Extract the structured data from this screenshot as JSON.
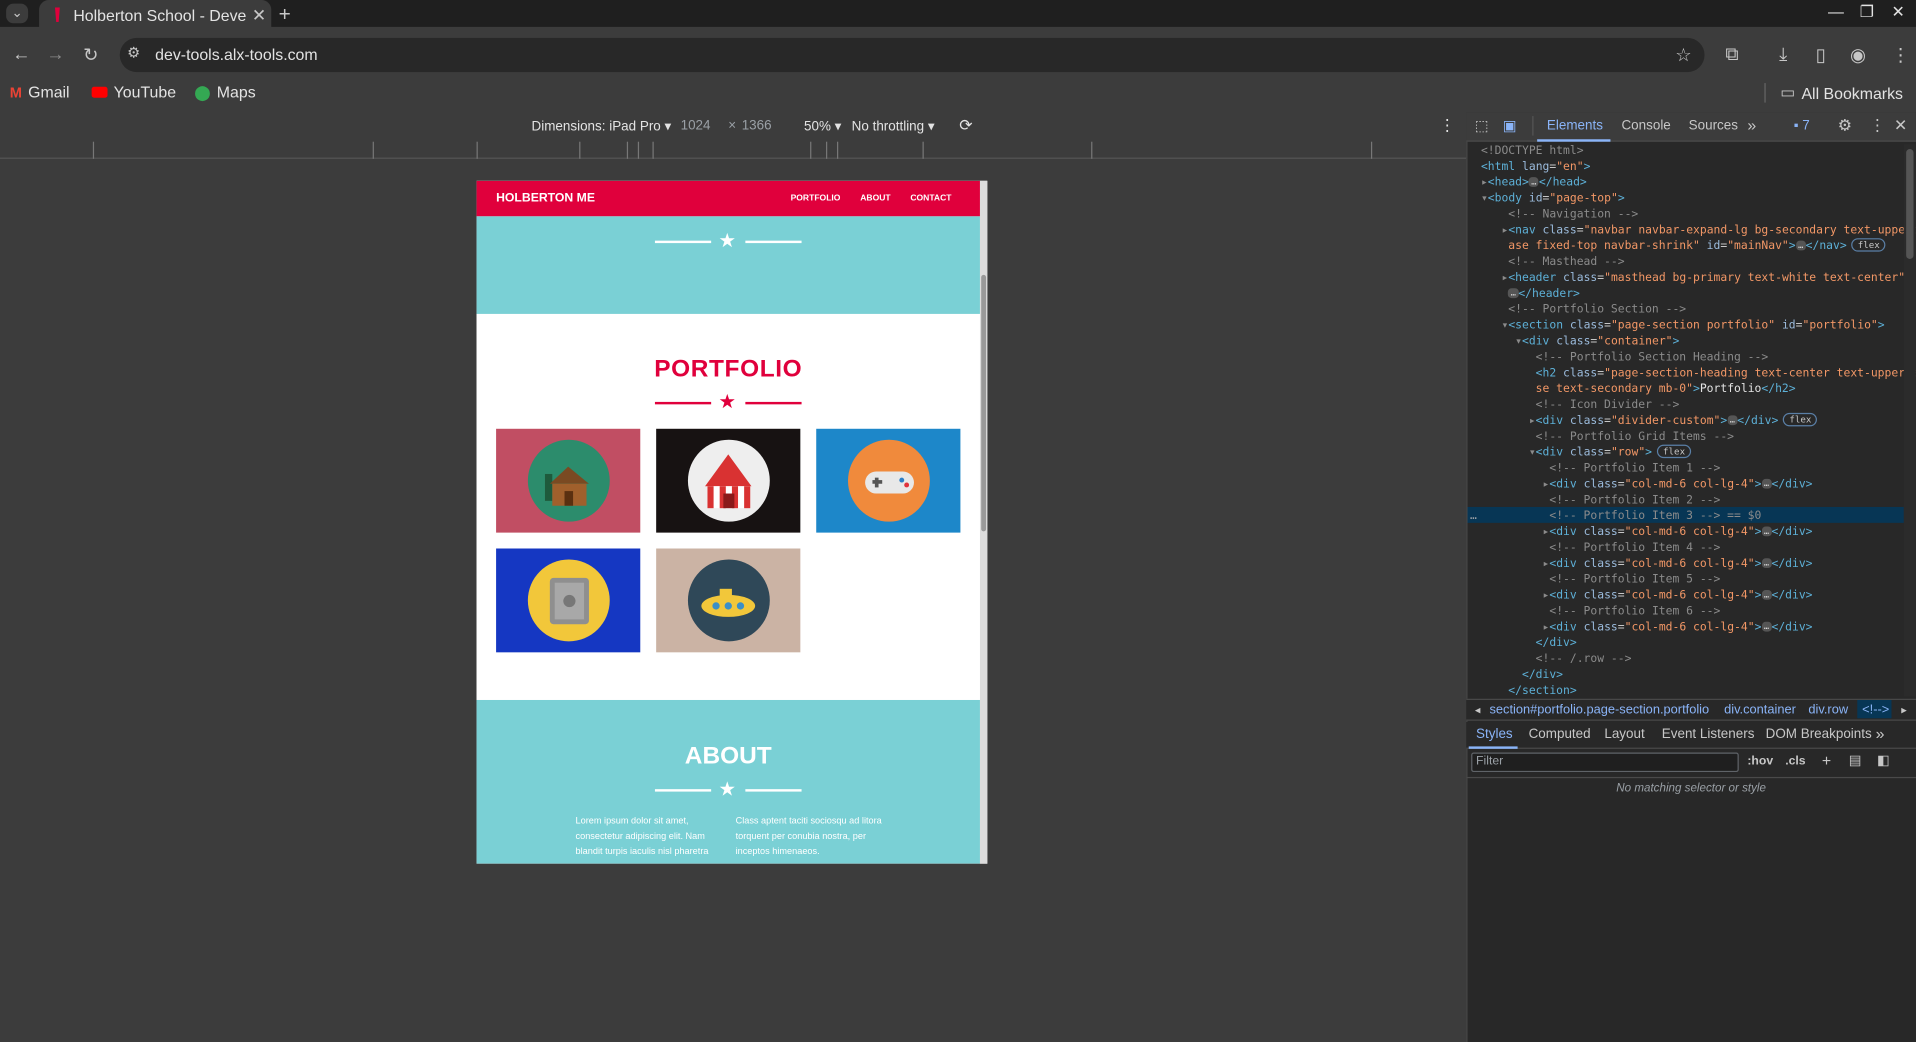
{
  "browser": {
    "tab_title": "Holberton School - Deve",
    "url": "dev-tools.alx-tools.com",
    "bookmarks": [
      "Gmail",
      "YouTube",
      "Maps"
    ],
    "all_bookmarks": "All Bookmarks"
  },
  "device_toolbar": {
    "dimensions": "Dimensions: iPad Pro",
    "width": "1024",
    "times": "×",
    "height": "1366",
    "zoom": "50%",
    "throttling": "No throttling"
  },
  "site": {
    "brand": "HOLBERTON ME",
    "nav": [
      "PORTFOLIO",
      "ABOUT",
      "CONTACT"
    ],
    "portfolio_title": "PORTFOLIO",
    "about_title": "ABOUT",
    "about_left": "Lorem ipsum dolor sit amet, consectetur adipiscing elit. Nam blandit turpis iaculis nisl pharetra",
    "about_right": "Class aptent taciti sociosqu ad litora torquent per conubia nostra, per inceptos himenaeos.",
    "tile_colors": [
      "#c14e63",
      "#171212",
      "#1d87c9",
      "#1537c2",
      "#cbb3a4"
    ]
  },
  "devtools": {
    "tabs": [
      "Elements",
      "Console",
      "Sources"
    ],
    "issues_count": "7",
    "breadcrumbs": [
      "section#portfolio.page-section.portfolio",
      "div.container",
      "div.row",
      "<!-->"
    ],
    "style_tabs": [
      "Styles",
      "Computed",
      "Layout",
      "Event Listeners",
      "DOM Breakpoints"
    ],
    "filter_placeholder": "Filter",
    "hov": ":hov",
    "cls": ".cls",
    "no_match": "No matching selector or style"
  }
}
